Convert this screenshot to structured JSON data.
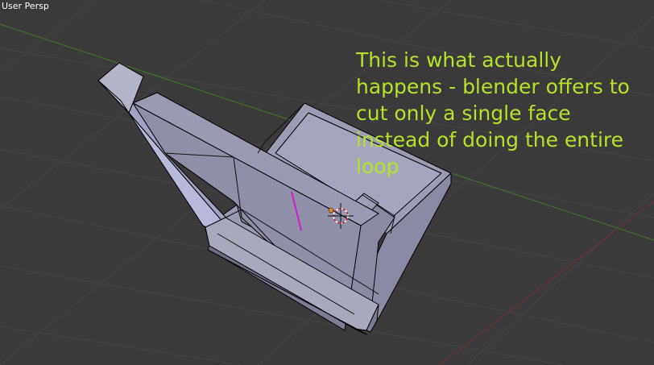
{
  "viewport": {
    "view_label": "User Persp",
    "background_color": "#3a3a3a",
    "grid_color": "#454545",
    "x_axis_color": "#7a2f2f",
    "y_axis_color": "#3f7a2a",
    "mesh_face_color": "#9c9cb4",
    "mesh_edge_color": "#000000",
    "cut_line_color": "#d01ad0",
    "icon": "3d-cursor-icon"
  },
  "annotation": {
    "color": "#b6e22a",
    "lines": [
      "This is what actually",
      "happens - blender offers to",
      "cut only a single face",
      "instead of doing the entire",
      "loop"
    ]
  }
}
